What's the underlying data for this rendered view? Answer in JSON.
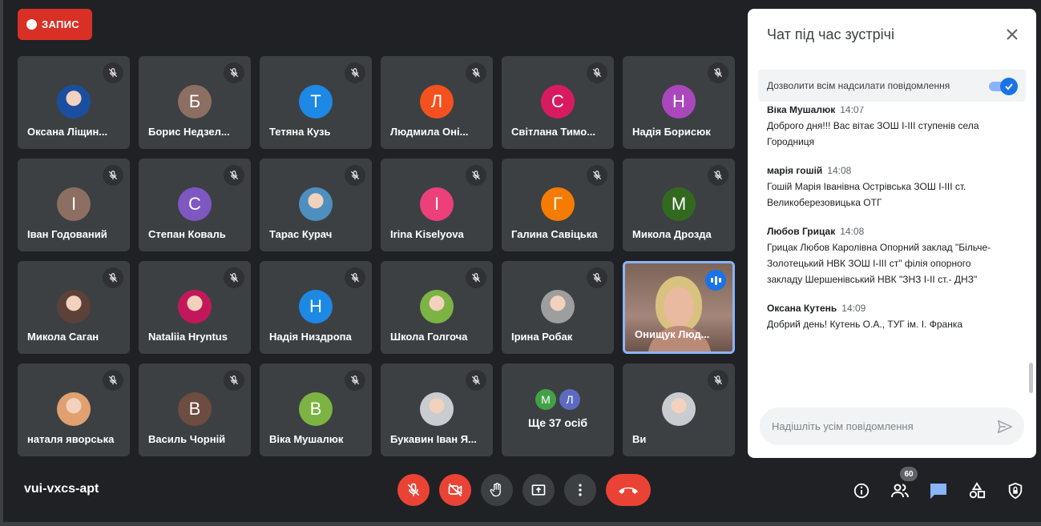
{
  "recording": {
    "label": "ЗАПИС"
  },
  "meeting": {
    "code": "vui-vxcs-apt"
  },
  "participants": [
    {
      "name": "Оксана Ліщин...",
      "initial": "",
      "color": "#1a4fa0",
      "photo": true
    },
    {
      "name": "Борис Недзел...",
      "initial": "Б",
      "color": "#8d6e63",
      "photo": false
    },
    {
      "name": "Тетяна Кузь",
      "initial": "Т",
      "color": "#1e88e5",
      "photo": false
    },
    {
      "name": "Людмила Оні...",
      "initial": "Л",
      "color": "#f4511e",
      "photo": false
    },
    {
      "name": "Світлана Тимо...",
      "initial": "С",
      "color": "#d81b60",
      "photo": false
    },
    {
      "name": "Надія Борисюк",
      "initial": "Н",
      "color": "#ab47bc",
      "photo": false
    },
    {
      "name": "Іван Годований",
      "initial": "І",
      "color": "#8d6e63",
      "photo": false
    },
    {
      "name": "Степан Коваль",
      "initial": "С",
      "color": "#7e57c2",
      "photo": false
    },
    {
      "name": "Тарас Курач",
      "initial": "",
      "color": "#4f8fc0",
      "photo": true
    },
    {
      "name": "Irina Kiselyova",
      "initial": "І",
      "color": "#ec407a",
      "photo": false
    },
    {
      "name": "Галина Савіцька",
      "initial": "Г",
      "color": "#f57c00",
      "photo": false
    },
    {
      "name": "Микола Дрозда",
      "initial": "М",
      "color": "#33691e",
      "photo": false
    },
    {
      "name": "Микола Саган",
      "initial": "",
      "color": "#5d4037",
      "photo": true
    },
    {
      "name": "Nataliia Hryntus",
      "initial": "",
      "color": "#c2185b",
      "photo": true
    },
    {
      "name": "Надія Низдропа",
      "initial": "Н",
      "color": "#1e88e5",
      "photo": false
    },
    {
      "name": "Школа Голгоча",
      "initial": "",
      "color": "#7cb342",
      "photo": true
    },
    {
      "name": "Ірина Робак",
      "initial": "",
      "color": "#9e9e9e",
      "photo": true
    },
    {
      "name": "Онищук Люд...",
      "initial": "",
      "color": "#a4867a",
      "photo": true,
      "speaking": true
    },
    {
      "name": "наталя яворська",
      "initial": "",
      "color": "#e0a070",
      "photo": true
    },
    {
      "name": "Василь Чорній",
      "initial": "В",
      "color": "#6d4c41",
      "photo": false
    },
    {
      "name": "Віка Мушалюк",
      "initial": "В",
      "color": "#7cb342",
      "photo": false
    },
    {
      "name": "Букавин Іван Я...",
      "initial": "",
      "color": "#c9ccd1",
      "photo": true
    },
    {
      "name": "Ще 37 осіб",
      "more": true,
      "initials": [
        "М",
        "Л"
      ],
      "colors": [
        "#43a047",
        "#5c6bc0"
      ]
    },
    {
      "name": "Ви",
      "initial": "",
      "color": "#c9ccd1",
      "photo": true
    }
  ],
  "chat": {
    "title": "Чат під час зустрічі",
    "allow_label": "Дозволити всім надсилати повідомлення",
    "input_placeholder": "Надішліть усім повідомлення",
    "messages": [
      {
        "sender": "Віка Мушалюк",
        "time": "14:07",
        "text": "Доброго дня!!! Вас вітає ЗОШ І-ІІІ ступенів села Городниця"
      },
      {
        "sender": "марія гошій",
        "time": "14:08",
        "text": "Гошій Марія Іванівна Острівська ЗОШ І-ІІІ ст. Великоберезовицька ОТГ"
      },
      {
        "sender": "Любов Грицак",
        "time": "14:08",
        "text": "Грицак Любов Каролівна Опорний заклад \"Більче-Золотецький НВК ЗОШ І-ІІІ ст\" філія опорного закладу Шершенівський НВК \"ЗНЗ І-ІІ ст.- ДНЗ\""
      },
      {
        "sender": "Оксана Кутень",
        "time": "14:09",
        "text": "Добрий день! Кутень О.А., ТУГ ім. І. Франка"
      }
    ]
  },
  "toolbar": {
    "people_count": "60"
  },
  "icons": [
    "record-dot-icon",
    "mic-off-icon",
    "close-icon",
    "checkmark-icon",
    "send-icon",
    "camera-off-icon",
    "raise-hand-icon",
    "present-icon",
    "more-icon",
    "end-call-icon",
    "info-icon",
    "people-icon",
    "chat-icon",
    "activities-icon",
    "host-controls-icon"
  ]
}
